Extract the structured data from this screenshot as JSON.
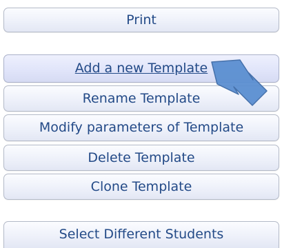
{
  "actions": {
    "print_label": "Print",
    "add_template_label": "Add a new Template",
    "rename_template_label": "Rename Template",
    "modify_template_label": "Modify parameters of Template",
    "delete_template_label": "Delete Template",
    "clone_template_label": "Clone Template",
    "select_students_label": "Select Different Students"
  },
  "pointer": {
    "icon": "arrow-pointer-icon",
    "color": "#5b8fd1",
    "outline": "#3d6aa6"
  },
  "theme": {
    "text_color": "#234a87",
    "button_border": "#b3b9c7"
  }
}
